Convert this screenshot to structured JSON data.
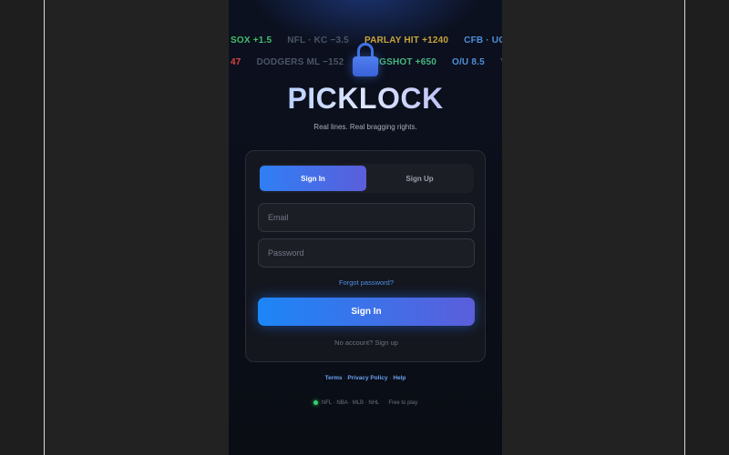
{
  "ticker": {
    "row1": [
      "SOX +1.5",
      "NFL · KC −3.5",
      "PARLAY HIT +1240",
      "CFB · UGA"
    ],
    "row2": [
      "47",
      "DODGERS ML −152",
      "LONGSHOT +650",
      "O/U 8.5",
      "YA"
    ]
  },
  "brand": {
    "name": "PICKLOCK",
    "tagline": "Real lines. Real bragging rights.",
    "logo_icon": "padlock-icon"
  },
  "auth": {
    "tabs": [
      {
        "label": "Sign In",
        "active": true
      },
      {
        "label": "Sign Up",
        "active": false
      }
    ],
    "email_placeholder": "Email",
    "password_placeholder": "Password",
    "forgot_label": "Forgot password?",
    "submit_label": "Sign In",
    "no_account_label": "No account? Sign up"
  },
  "footer": {
    "links": [
      "Terms",
      "Privacy Policy",
      "Help"
    ],
    "separator": "·",
    "leagues": "NFL · NBA · MLB · NHL",
    "free_label": "Free to play",
    "status_color": "#36d16b"
  },
  "colors": {
    "accent_start": "#1c86f7",
    "accent_end": "#5b5edb",
    "background": "#0b0f1a"
  }
}
